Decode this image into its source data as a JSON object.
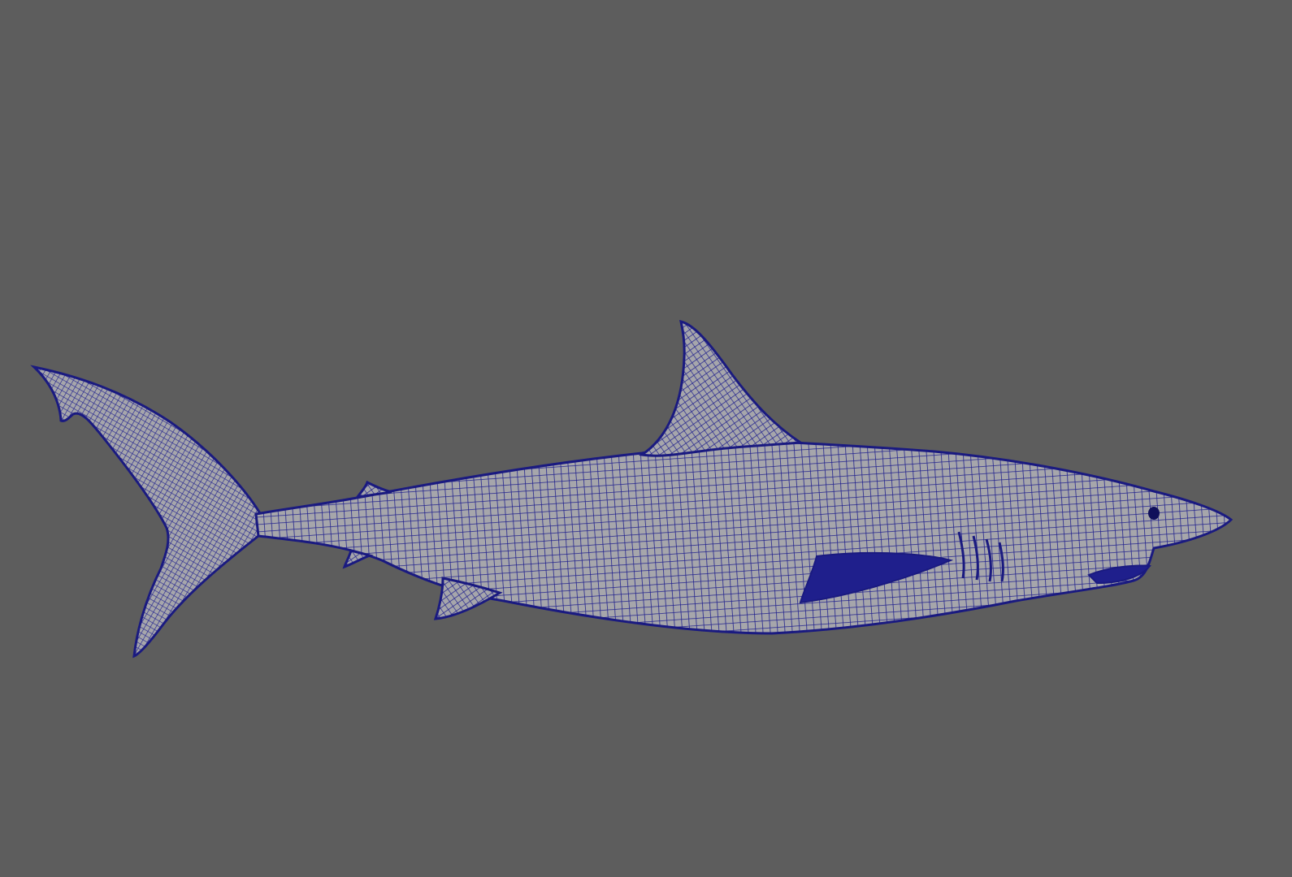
{
  "viewport": {
    "background_color": "#5d5d5d",
    "display_mode": "wireframe-on-shaded",
    "model": {
      "name": "shark-mesh",
      "wire_color": "#1f1f8c",
      "shaded_color": "#a8a8a8"
    }
  }
}
